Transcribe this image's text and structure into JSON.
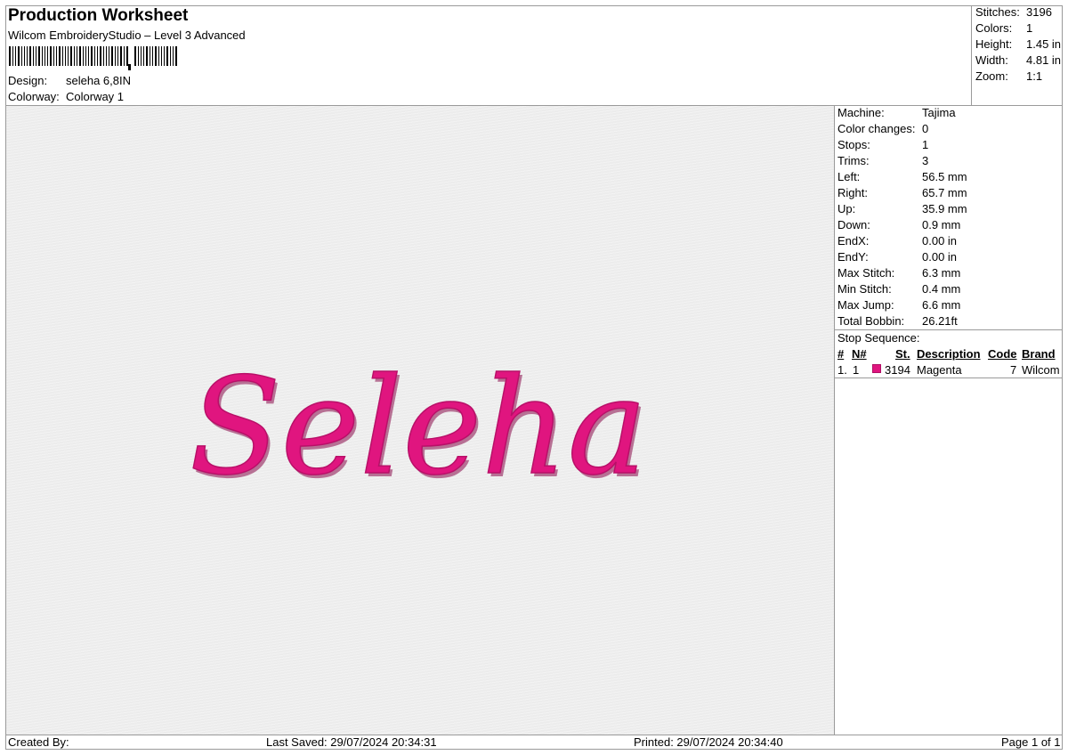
{
  "header": {
    "title": "Production Worksheet",
    "subtitle": "Wilcom EmbroideryStudio – Level 3 Advanced",
    "design_label": "Design:",
    "design_value": "seleha 6,8IN",
    "colorway_label": "Colorway:",
    "colorway_value": "Colorway 1"
  },
  "summary": [
    {
      "label": "Stitches:",
      "value": "3196"
    },
    {
      "label": "Colors:",
      "value": "1"
    },
    {
      "label": "Height:",
      "value": "1.45 in"
    },
    {
      "label": "Width:",
      "value": "4.81 in"
    },
    {
      "label": "Zoom:",
      "value": "1:1"
    }
  ],
  "design": {
    "text": "Seleha",
    "color": "#e0157f"
  },
  "machine_info": [
    {
      "label": "Machine:",
      "value": "Tajima"
    },
    {
      "label": "Color changes:",
      "value": "0"
    },
    {
      "label": "Stops:",
      "value": "1"
    },
    {
      "label": "Trims:",
      "value": "3"
    },
    {
      "label": "Left:",
      "value": "56.5 mm"
    },
    {
      "label": "Right:",
      "value": "65.7 mm"
    },
    {
      "label": "Up:",
      "value": "35.9 mm"
    },
    {
      "label": "Down:",
      "value": "0.9 mm"
    },
    {
      "label": "EndX:",
      "value": "0.00 in"
    },
    {
      "label": "EndY:",
      "value": "0.00 in"
    },
    {
      "label": "Max Stitch:",
      "value": "6.3 mm"
    },
    {
      "label": "Min Stitch:",
      "value": "0.4 mm"
    },
    {
      "label": "Max Jump:",
      "value": "6.6 mm"
    },
    {
      "label": "Total Bobbin:",
      "value": "26.21ft"
    }
  ],
  "stop_sequence": {
    "title": "Stop Sequence:",
    "headers": {
      "num": "#",
      "n": "N#",
      "st": "St.",
      "desc": "Description",
      "code": "Code",
      "brand": "Brand"
    },
    "rows": [
      {
        "num": "1.",
        "n": "1",
        "st": "3194",
        "desc": "Magenta",
        "code": "7",
        "brand": "Wilcom",
        "color": "#e0157f"
      }
    ]
  },
  "footer": {
    "created_by": "Created By:",
    "last_saved": "Last Saved: 29/07/2024 20:34:31",
    "printed": "Printed: 29/07/2024 20:34:40",
    "page": "Page 1 of 1"
  }
}
